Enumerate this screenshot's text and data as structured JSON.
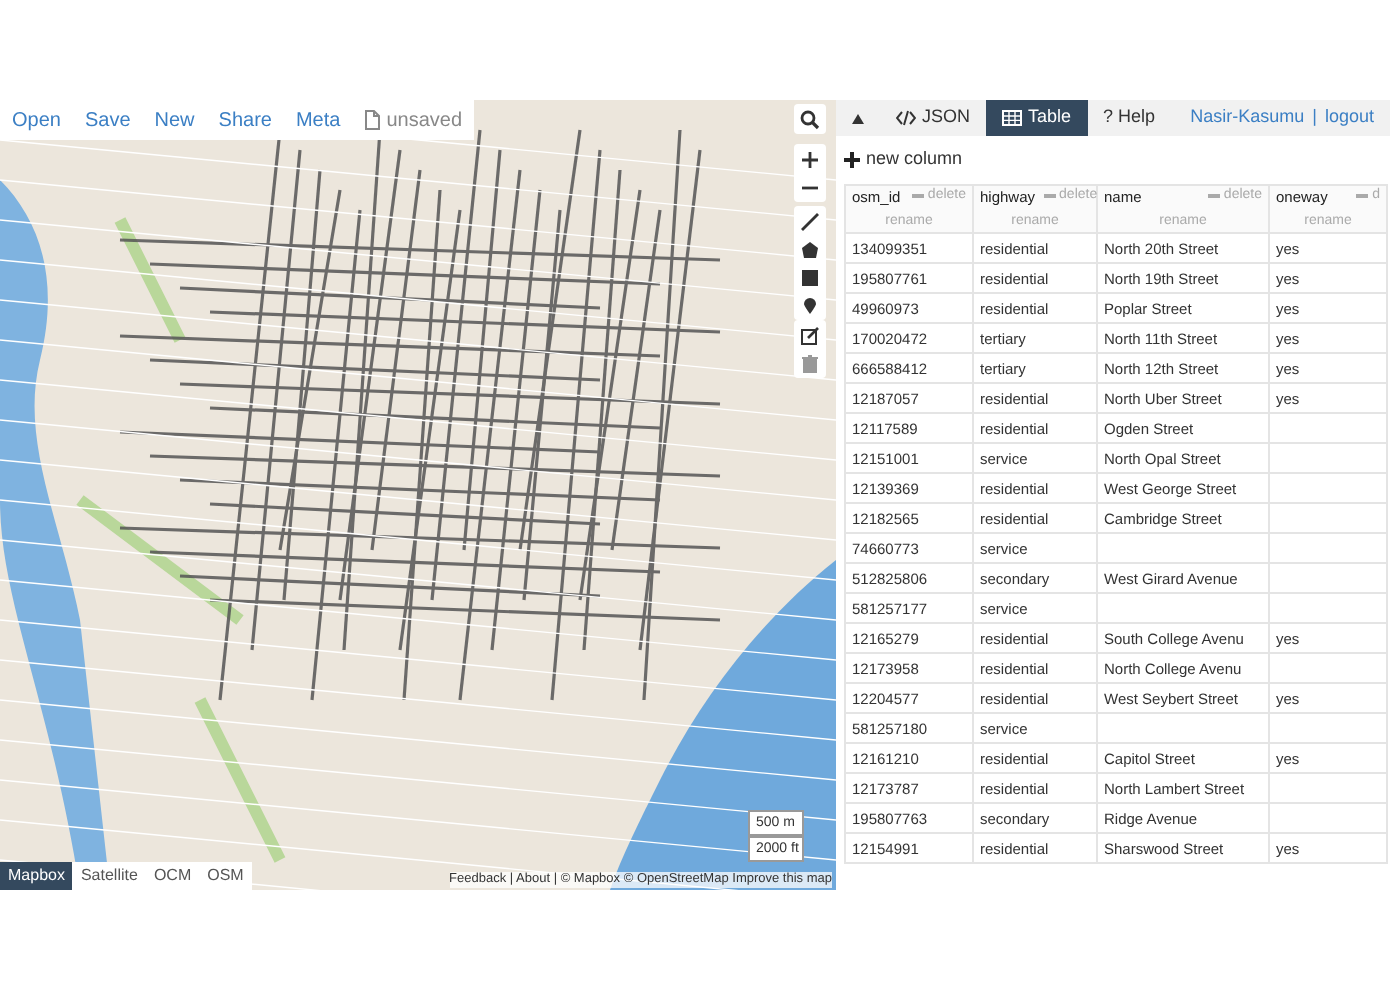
{
  "toolbar": {
    "items": [
      "Open",
      "Save",
      "New",
      "Share",
      "Meta"
    ],
    "file_status": "unsaved"
  },
  "layers": [
    {
      "label": "Mapbox",
      "selected": true
    },
    {
      "label": "Satellite",
      "selected": false
    },
    {
      "label": "OCM",
      "selected": false
    },
    {
      "label": "OSM",
      "selected": false
    }
  ],
  "scale": [
    "500 m",
    "2000 ft"
  ],
  "attribution": "Feedback | About | © Mapbox © OpenStreetMap Improve this map",
  "panel": {
    "tabs": [
      {
        "label": "JSON",
        "kind": "code",
        "selected": false
      },
      {
        "label": "Table",
        "kind": "table",
        "selected": true
      },
      {
        "label": "? Help",
        "kind": "help",
        "selected": false
      }
    ],
    "user": "Nasir-Kasumu",
    "separator": "|",
    "logout": "logout"
  },
  "table": {
    "new_column": "new column",
    "columns": [
      {
        "name": "osm_id",
        "delete": "delete",
        "rename": "rename"
      },
      {
        "name": "highway",
        "delete": "delete",
        "rename": "rename"
      },
      {
        "name": "name",
        "delete": "delete",
        "rename": "rename"
      },
      {
        "name": "oneway",
        "delete": "d",
        "rename": "rename"
      }
    ],
    "rows": [
      {
        "osm_id": "134099351",
        "highway": "residential",
        "name": "North 20th Street",
        "oneway": "yes"
      },
      {
        "osm_id": "195807761",
        "highway": "residential",
        "name": "North 19th Street",
        "oneway": "yes"
      },
      {
        "osm_id": "49960973",
        "highway": "residential",
        "name": "Poplar Street",
        "oneway": "yes"
      },
      {
        "osm_id": "170020472",
        "highway": "tertiary",
        "name": "North 11th Street",
        "oneway": "yes"
      },
      {
        "osm_id": "666588412",
        "highway": "tertiary",
        "name": "North 12th Street",
        "oneway": "yes"
      },
      {
        "osm_id": "12187057",
        "highway": "residential",
        "name": "North Uber Street",
        "oneway": "yes"
      },
      {
        "osm_id": "12117589",
        "highway": "residential",
        "name": "Ogden Street"
      },
      {
        "osm_id": "12151001",
        "highway": "service",
        "name": "North Opal Street"
      },
      {
        "osm_id": "12139369",
        "highway": "residential",
        "name": "West George Street"
      },
      {
        "osm_id": "12182565",
        "highway": "residential",
        "name": "Cambridge Street"
      },
      {
        "osm_id": "74660773",
        "highway": "service"
      },
      {
        "osm_id": "512825806",
        "highway": "secondary",
        "name": "West Girard Avenue"
      },
      {
        "osm_id": "581257177",
        "highway": "service"
      },
      {
        "osm_id": "12165279",
        "highway": "residential",
        "name": "South College Avenu",
        "oneway": "yes"
      },
      {
        "osm_id": "12173958",
        "highway": "residential",
        "name": "North College Avenu"
      },
      {
        "osm_id": "12204577",
        "highway": "residential",
        "name": "West Seybert Street",
        "oneway": "yes"
      },
      {
        "osm_id": "581257180",
        "highway": "service"
      },
      {
        "osm_id": "12161210",
        "highway": "residential",
        "name": "Capitol Street",
        "oneway": "yes"
      },
      {
        "osm_id": "12173787",
        "highway": "residential",
        "name": "North Lambert Street"
      },
      {
        "osm_id": "195807763",
        "highway": "secondary",
        "name": "Ridge Avenue"
      },
      {
        "osm_id": "12154991",
        "highway": "residential",
        "name": "Sharswood Street",
        "oneway": "yes"
      }
    ]
  }
}
